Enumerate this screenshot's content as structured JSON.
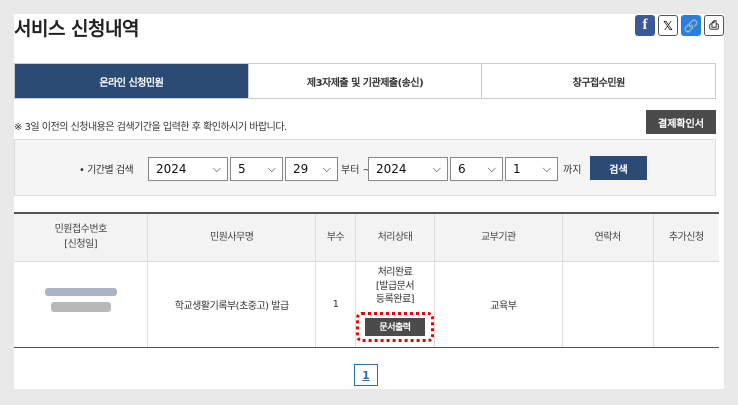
{
  "header": {
    "title": "서비스 신청내역",
    "share_icons": [
      "facebook-icon",
      "x-icon",
      "link-icon",
      "print-icon"
    ],
    "facebook_glyph": "f",
    "x_glyph": "𝕏",
    "link_glyph": "🔗",
    "print_glyph": "⎙"
  },
  "tabs": [
    {
      "label": "온라인 신청민원",
      "active": true
    },
    {
      "label": "제3자제출 및 기관제출(송신)",
      "active": false
    },
    {
      "label": "창구접수민원",
      "active": false
    }
  ],
  "notice": "※ 3일 이전의 신청내용은 검색기간을 입력한 후 확인하시기 바랍니다.",
  "cert_button": "결제확인서",
  "search": {
    "label": "• 기간별 검색",
    "from": {
      "year": "2024",
      "month": "5",
      "day": "29"
    },
    "between": "부터 ~",
    "to": {
      "year": "2024",
      "month": "6",
      "day": "1"
    },
    "until": "까지",
    "button": "검색"
  },
  "table": {
    "headers": [
      "민원접수번호\n[신청일]",
      "민원사무명",
      "부수",
      "처리상태",
      "교부기관",
      "연락처",
      "추가신청"
    ],
    "rows": [
      {
        "service_name": "학교생활기록부(초중고) 발급",
        "copies": "1",
        "status": "처리완료\n[발급문서\n등록완료]",
        "doc_button": "문서출력",
        "agency": "교육부",
        "contact": "",
        "extra": ""
      }
    ]
  },
  "pagination": {
    "current": "1"
  },
  "colors": {
    "accent": "#2b4a74",
    "dark_button": "#4b4b4b",
    "highlight": "#e00000",
    "link": "#2a6fb0"
  }
}
